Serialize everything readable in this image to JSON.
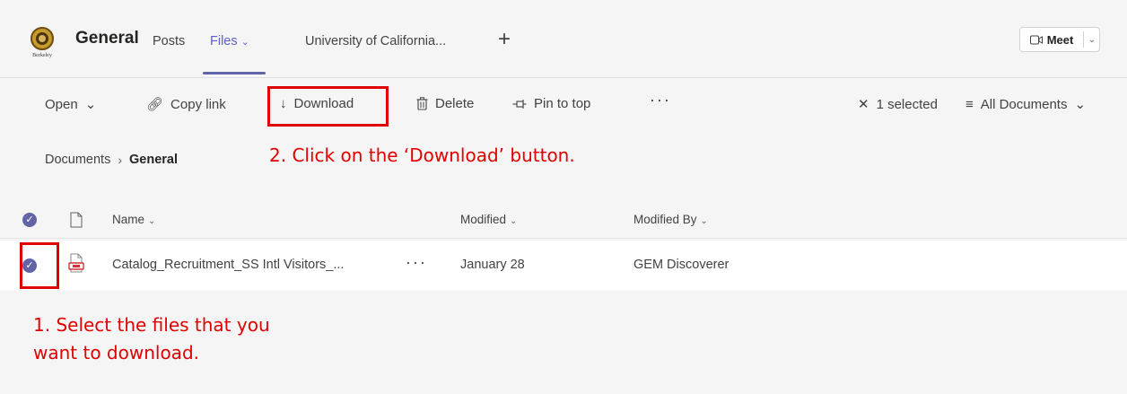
{
  "header": {
    "logo_text": "Berkeley",
    "channel_name": "General",
    "tabs": [
      {
        "label": "Posts"
      },
      {
        "label": "Files",
        "active": true
      },
      {
        "label": "University of California..."
      }
    ],
    "add_tab_icon": "plus-icon",
    "meet_label": "Meet",
    "accent_color": "#6264a7"
  },
  "toolbar": {
    "open_label": "Open",
    "copy_link_label": "Copy link",
    "download_label": "Download",
    "delete_label": "Delete",
    "pin_label": "Pin to top",
    "more_label": "···",
    "selected_label": "1 selected",
    "view_label": "All Documents"
  },
  "breadcrumb": {
    "root": "Documents",
    "current": "General"
  },
  "table": {
    "columns": [
      {
        "label": "Name"
      },
      {
        "label": "Modified"
      },
      {
        "label": "Modified By"
      }
    ],
    "rows": [
      {
        "name": "Catalog_Recruitment_SS Intl Visitors_...",
        "more": "···",
        "modified": "January 28",
        "modified_by": "GEM Discoverer",
        "file_icon": "pdf-file-icon",
        "selected": true
      }
    ]
  },
  "annotations": {
    "step2": "2. Click on the ‘Download’ button.",
    "step1_line1": "1. Select the files that you",
    "step1_line2": "want to download.",
    "color": "#e00000"
  }
}
